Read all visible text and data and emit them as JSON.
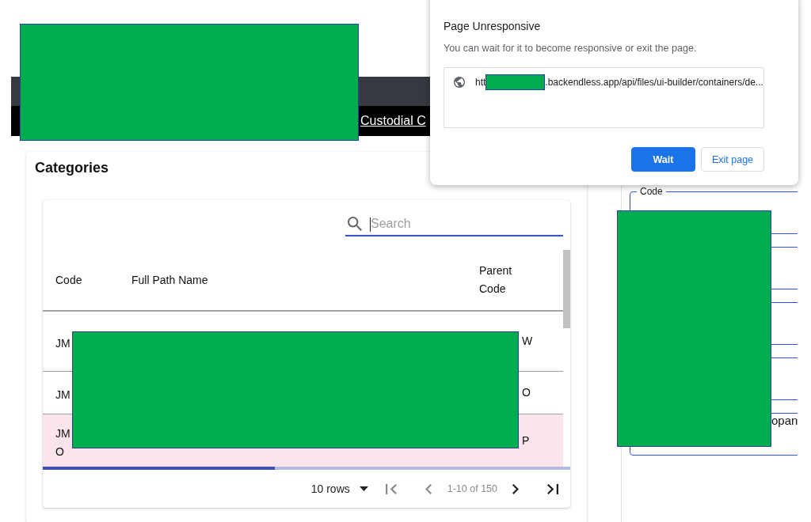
{
  "dialog": {
    "title": "Page Unresponsive",
    "message": "You can wait for it to become responsive or exit the page.",
    "url_parts": [
      "htt",
      ".backendless.app/api/files/ui-builder/containers/de..."
    ],
    "buttons": [
      {
        "label": "Wait",
        "kind": "primary"
      },
      {
        "label": "Exit page",
        "kind": "secondary"
      }
    ]
  },
  "nav_bar": {
    "links": [
      "Custodial C"
    ]
  },
  "categories": {
    "title": "Categories",
    "search": {
      "placeholder": "Search",
      "focused": true
    },
    "table": {
      "columns": [
        "Code",
        "Full Path Name",
        "Parent Code"
      ],
      "rows": [
        {
          "code": "JM",
          "parent_code": "W",
          "selected": false
        },
        {
          "code": "JM",
          "parent_code": "O",
          "selected": false
        },
        {
          "code": "JM\nO",
          "parent_code": "P",
          "selected": true
        }
      ]
    },
    "loading": {
      "level": 0.44
    },
    "pagination": {
      "rows_per_page": "10 rows",
      "range": "1-10 of 150",
      "buttons": [
        {
          "kind": "first",
          "disabled": true
        },
        {
          "kind": "previous",
          "disabled": true
        },
        {
          "kind": "next",
          "disabled": false
        },
        {
          "kind": "last",
          "disabled": false
        }
      ]
    }
  },
  "detail_form": {
    "fields": [
      {
        "kind": "outlined",
        "label": "Code"
      },
      {
        "kind": "outlined"
      },
      {
        "kind": "outlined"
      },
      {
        "kind": "outlined"
      },
      {
        "kind": "outlined",
        "value": "opan"
      }
    ]
  }
}
